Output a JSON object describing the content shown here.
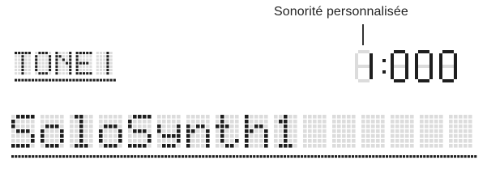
{
  "annotation": {
    "label": "Sonorité personnalisée"
  },
  "display": {
    "mode": "TONE",
    "tone_number": "1:000",
    "tone_name": "SoloSynth1"
  }
}
